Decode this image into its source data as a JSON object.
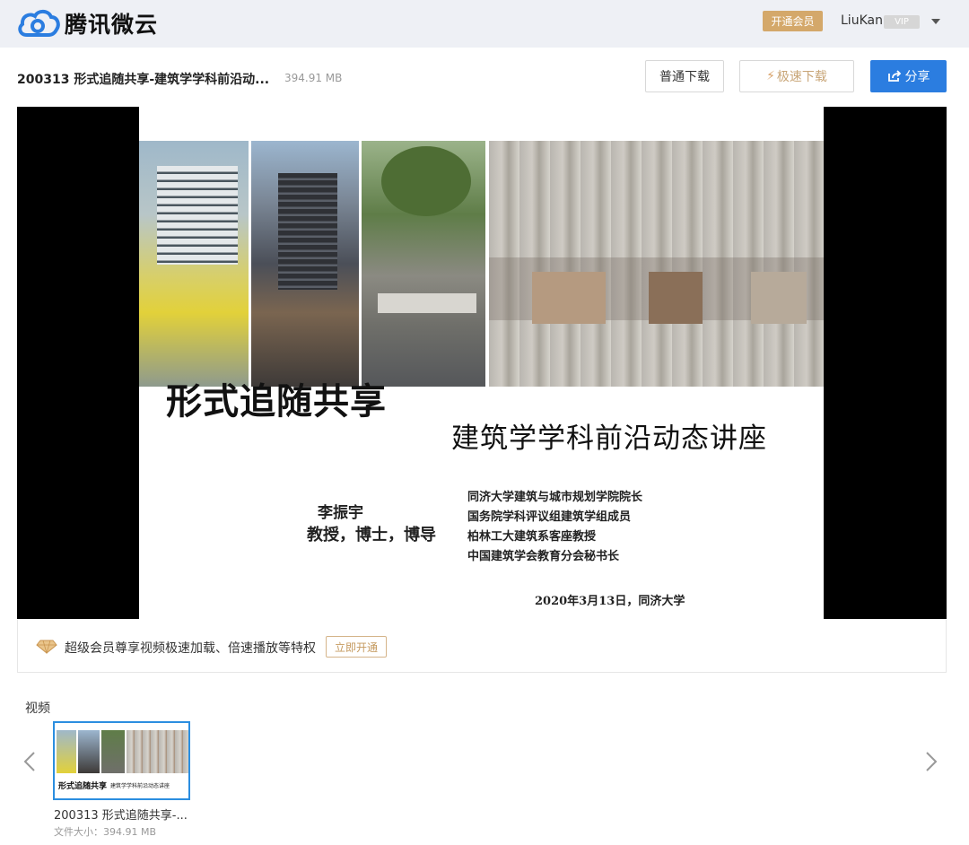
{
  "app": {
    "name": "腾讯微云",
    "brand_color": "#2b7de0"
  },
  "header": {
    "vip_open_label": "开通会员",
    "username": "LiuKan",
    "vip_badge": "VIP"
  },
  "file": {
    "name": "200313 形式追随共享-建筑学学科前沿动...",
    "size": "394.91 MB"
  },
  "toolbar": {
    "normal_download_label": "普通下载",
    "fast_download_label": "极速下载",
    "share_label": "分享"
  },
  "slide": {
    "title": "形式追随共享",
    "subtitle": "建筑学学科前沿动态讲座",
    "author_name": "李振宇",
    "author_title": "教授，博士，博导",
    "roles": [
      "同济大学建筑与城市规划学院院长",
      "国务院学科评议组建筑学组成员",
      "柏林工大建筑系客座教授",
      "中国建筑学会教育分会秘书长"
    ],
    "date_line": "2020年3月13日，同济大学"
  },
  "promo": {
    "text": "超级会员尊享视频极速加载、倍速播放等特权",
    "button_label": "立即开通"
  },
  "video_list": {
    "section_label": "视频",
    "items": [
      {
        "thumb_title": "形式追随共享",
        "thumb_subtitle": "建筑学学科前沿动态讲座",
        "name": "200313 形式追随共享-...",
        "size_text": "文件大小：394.91 MB"
      }
    ]
  },
  "icons": {
    "logo": "cloud-logo-icon",
    "caret": "chevron-down-icon",
    "bolt": "bolt-icon",
    "share": "share-icon",
    "diamond": "diamond-icon",
    "prev": "chevron-left-icon",
    "next": "chevron-right-icon"
  }
}
